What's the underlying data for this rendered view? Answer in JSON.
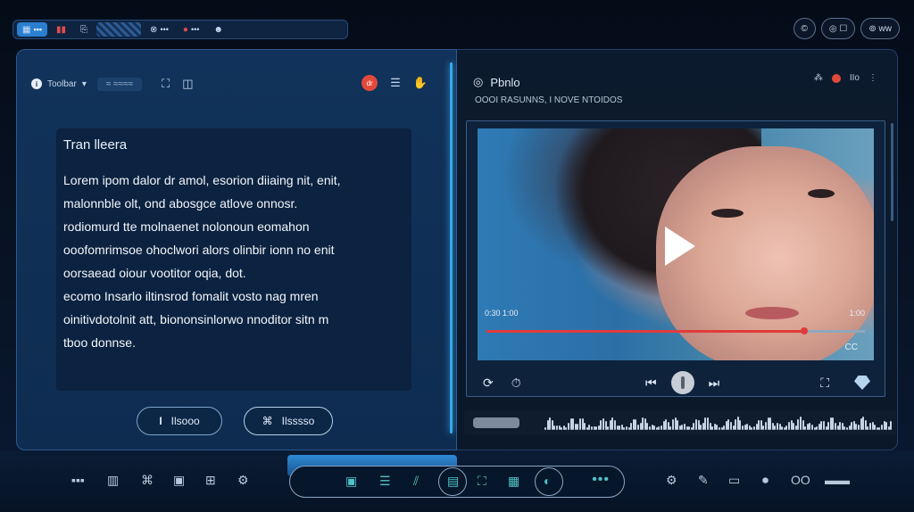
{
  "topbar": {
    "items": [
      {
        "label": "▪▪▪",
        "icon": "grid-icon"
      },
      {
        "label": "",
        "icon": "alert-icon"
      },
      {
        "label": "",
        "icon": "clipboard-icon"
      },
      {
        "label": "",
        "icon": "pattern-icon"
      },
      {
        "label": "•••",
        "icon": "link-icon"
      },
      {
        "label": "•••",
        "icon": "record-icon"
      },
      {
        "label": "",
        "icon": "people-icon"
      }
    ],
    "right_pills": [
      {
        "label": "©",
        "icon": "clock-icon"
      },
      {
        "label": "◎ ☐",
        "icon": "settings-icon"
      },
      {
        "label": "⊚ ww",
        "icon": "user-icon"
      }
    ]
  },
  "editor": {
    "tab_label": "Toolbar",
    "tab_suffix": "▾",
    "tab2_label": "≈ ≈≈≈≈",
    "tab_badge": "i",
    "rec_badge": "dr",
    "doc_title": "Tran lleera",
    "doc_lines": [
      "Lorem ipom dalor dr amol,  esorion diiaing nit, enit,",
      "malonnble olt, ond abosgce atlove onnosr.",
      "rodiomurd tte molnaenet nolonoun eomahon",
      "ooofomrimsoe ohoclwori alors olinbir ionn no enit",
      "oorsaead oiour vootitor oqia, dot.",
      "ecomo Insarlo iltinsrod fomalit vosto nag mren",
      "oinitivdotolnit att, biononsinlorwo nnoditor sitn m",
      "tboo donnse."
    ],
    "btn_primary": "Ilsooo",
    "btn_primary_icon": "I",
    "btn_secondary": "Ilsssso",
    "btn_secondary_icon": "⌘"
  },
  "player": {
    "title": "Pbnlo",
    "subtitle": "OOOI RASUNNS, I NOVE NTOIDOS",
    "time_elapsed": "0:30 1:00",
    "time_total": "1:00",
    "cc_label": "CC",
    "ctrl_a": "«",
    "ctrl_b": "Ib",
    "progress_fraction": 0.84,
    "wave_label": "▬▬▬▬▬▬ ▬ ▬▬ ▬▬ ▬▬"
  },
  "dock": {
    "left_items": [
      "▪▪▪",
      "▥",
      "⌘",
      "▣",
      "⊞",
      "⚙"
    ],
    "center_items": [
      "▣",
      "☰",
      "⫽",
      "▤",
      "⛶",
      "▦",
      "◐"
    ],
    "dots": "•••",
    "right_items": [
      "⚙",
      "✎",
      "▭",
      "⏺",
      "OO",
      "▬▬"
    ]
  },
  "colors": {
    "accent": "#2a7fd0",
    "record": "#e14a3b",
    "progress": "#e13b3b",
    "dock_icon": "#51c2c9"
  }
}
